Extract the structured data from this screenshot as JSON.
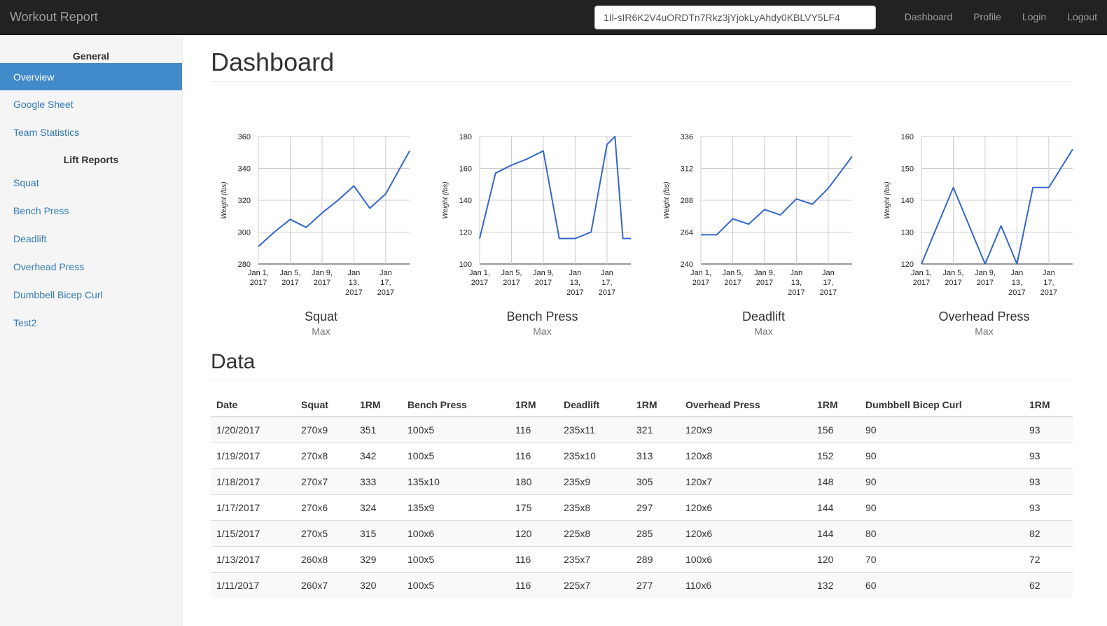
{
  "navbar": {
    "brand": "Workout Report",
    "search_value": "1Il-sIR6K2V4uORDTn7Rkz3jYjokLyAhdy0KBLVY5LF4",
    "links": [
      "Dashboard",
      "Profile",
      "Login",
      "Logout"
    ]
  },
  "sidebar": {
    "general_heading": "General",
    "general_items": [
      "Overview",
      "Google Sheet",
      "Team Statistics"
    ],
    "active_item": "Overview",
    "lift_heading": "Lift Reports",
    "lift_items": [
      "Squat",
      "Bench Press",
      "Deadlift",
      "Overhead Press",
      "Dumbbell Bicep Curl",
      "Test2"
    ]
  },
  "main": {
    "title": "Dashboard",
    "data_heading": "Data"
  },
  "colors": {
    "line": "#3366cc",
    "grid": "#cccccc",
    "accent": "#428bca",
    "navbar": "#222222"
  },
  "chart_data": [
    {
      "type": "line",
      "title": "Squat",
      "subtitle": "Max",
      "xlabel": "",
      "ylabel": "Weight (lbs)",
      "ylim": [
        280,
        360
      ],
      "yticks": [
        280,
        300,
        320,
        340,
        360
      ],
      "xlim": [
        1,
        20
      ],
      "xticks": [
        1,
        5,
        9,
        13,
        17
      ],
      "xtick_labels": [
        [
          "Jan 1,",
          "2017"
        ],
        [
          "Jan 5,",
          "2017"
        ],
        [
          "Jan 9,",
          "2017"
        ],
        [
          "Jan",
          "13,",
          "2017"
        ],
        [
          "Jan",
          "17,",
          "2017"
        ]
      ],
      "grid": true,
      "x": [
        1,
        3,
        5,
        7,
        9,
        11,
        13,
        15,
        17,
        18,
        19,
        20
      ],
      "values": [
        291,
        300,
        308,
        303,
        312,
        320,
        329,
        315,
        324,
        333,
        342,
        351
      ]
    },
    {
      "type": "line",
      "title": "Bench Press",
      "subtitle": "Max",
      "xlabel": "",
      "ylabel": "Weight (lbs)",
      "ylim": [
        100,
        180
      ],
      "yticks": [
        100,
        120,
        140,
        160,
        180
      ],
      "xlim": [
        1,
        20
      ],
      "xticks": [
        1,
        5,
        9,
        13,
        17
      ],
      "xtick_labels": [
        [
          "Jan 1,",
          "2017"
        ],
        [
          "Jan 5,",
          "2017"
        ],
        [
          "Jan 9,",
          "2017"
        ],
        [
          "Jan",
          "13,",
          "2017"
        ],
        [
          "Jan",
          "17,",
          "2017"
        ]
      ],
      "grid": true,
      "x": [
        1,
        3,
        5,
        7,
        9,
        11,
        13,
        15,
        17,
        18,
        19,
        20
      ],
      "values": [
        116,
        157,
        162,
        166,
        171,
        116,
        116,
        120,
        175,
        180,
        116,
        116
      ]
    },
    {
      "type": "line",
      "title": "Deadlift",
      "subtitle": "Max",
      "xlabel": "",
      "ylabel": "Weight (lbs)",
      "ylim": [
        240,
        336
      ],
      "yticks": [
        240,
        264,
        288,
        312,
        336
      ],
      "xlim": [
        1,
        20
      ],
      "xticks": [
        1,
        5,
        9,
        13,
        17
      ],
      "xtick_labels": [
        [
          "Jan 1,",
          "2017"
        ],
        [
          "Jan 5,",
          "2017"
        ],
        [
          "Jan 9,",
          "2017"
        ],
        [
          "Jan",
          "13,",
          "2017"
        ],
        [
          "Jan",
          "17,",
          "2017"
        ]
      ],
      "grid": true,
      "x": [
        1,
        3,
        5,
        7,
        9,
        11,
        13,
        15,
        17,
        18,
        19,
        20
      ],
      "values": [
        262,
        262,
        274,
        270,
        281,
        277,
        289,
        285,
        297,
        305,
        313,
        321
      ]
    },
    {
      "type": "line",
      "title": "Overhead Press",
      "subtitle": "Max",
      "xlabel": "",
      "ylabel": "Weight (lbs)",
      "ylim": [
        120,
        160
      ],
      "yticks": [
        120,
        130,
        140,
        150,
        160
      ],
      "xlim": [
        1,
        20
      ],
      "xticks": [
        1,
        5,
        9,
        13,
        17
      ],
      "xtick_labels": [
        [
          "Jan 1,",
          "2017"
        ],
        [
          "Jan 5,",
          "2017"
        ],
        [
          "Jan 9,",
          "2017"
        ],
        [
          "Jan",
          "13,",
          "2017"
        ],
        [
          "Jan",
          "17,",
          "2017"
        ]
      ],
      "grid": true,
      "x": [
        1,
        3,
        5,
        7,
        9,
        11,
        13,
        15,
        17,
        18,
        19,
        20
      ],
      "values": [
        120,
        132,
        144,
        132,
        120,
        132,
        120,
        144,
        144,
        148,
        152,
        156
      ]
    }
  ],
  "table": {
    "headers": [
      "Date",
      "Squat",
      "1RM",
      "Bench Press",
      "1RM",
      "Deadlift",
      "1RM",
      "Overhead Press",
      "1RM",
      "Dumbbell Bicep Curl",
      "1RM"
    ],
    "rows": [
      [
        "1/20/2017",
        "270x9",
        "351",
        "100x5",
        "116",
        "235x11",
        "321",
        "120x9",
        "156",
        "90",
        "93"
      ],
      [
        "1/19/2017",
        "270x8",
        "342",
        "100x5",
        "116",
        "235x10",
        "313",
        "120x8",
        "152",
        "90",
        "93"
      ],
      [
        "1/18/2017",
        "270x7",
        "333",
        "135x10",
        "180",
        "235x9",
        "305",
        "120x7",
        "148",
        "90",
        "93"
      ],
      [
        "1/17/2017",
        "270x6",
        "324",
        "135x9",
        "175",
        "235x8",
        "297",
        "120x6",
        "144",
        "90",
        "93"
      ],
      [
        "1/15/2017",
        "270x5",
        "315",
        "100x6",
        "120",
        "225x8",
        "285",
        "120x6",
        "144",
        "80",
        "82"
      ],
      [
        "1/13/2017",
        "260x8",
        "329",
        "100x5",
        "116",
        "235x7",
        "289",
        "100x6",
        "120",
        "70",
        "72"
      ],
      [
        "1/11/2017",
        "260x7",
        "320",
        "100x5",
        "116",
        "225x7",
        "277",
        "110x6",
        "132",
        "60",
        "62"
      ]
    ]
  }
}
